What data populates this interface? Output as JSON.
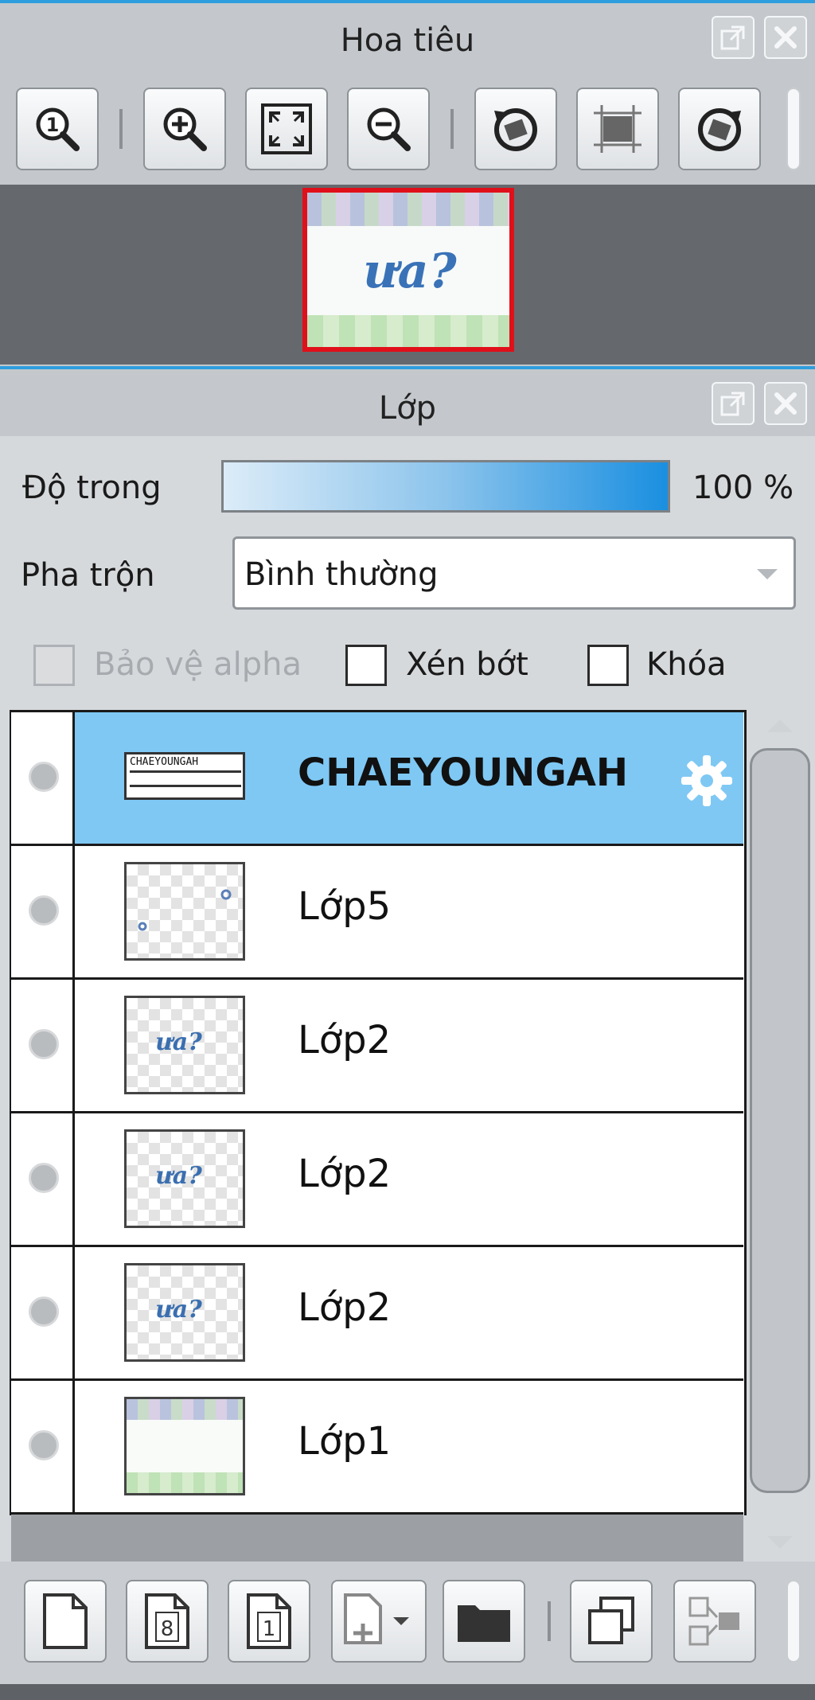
{
  "navigator": {
    "title": "Hoa tiêu",
    "toolbar_icons": [
      "zoom-actual-icon",
      "zoom-in-icon",
      "fit-screen-icon",
      "zoom-out-icon",
      "rotate-left-icon",
      "reset-rotation-icon",
      "rotate-right-icon"
    ],
    "preview_text": "ưa?"
  },
  "layers_panel": {
    "title": "Lớp",
    "opacity_label": "Độ trong",
    "opacity_value": "100 %",
    "opacity_percent": 100,
    "blend_label": "Pha trộn",
    "blend_value": "Bình thường",
    "protect_alpha_label": "Bảo vệ alpha",
    "clip_label": "Xén bớt",
    "lock_label": "Khóa",
    "layers": [
      {
        "name": "CHAEYOUNGAH",
        "selected": true,
        "thumb_text": "CHAEYOUNGAH"
      },
      {
        "name": "Lớp5",
        "selected": false,
        "thumb_text": ""
      },
      {
        "name": "Lớp2",
        "selected": false,
        "thumb_text": "ưa?"
      },
      {
        "name": "Lớp2",
        "selected": false,
        "thumb_text": "ưa?"
      },
      {
        "name": "Lớp2",
        "selected": false,
        "thumb_text": "ưa?"
      },
      {
        "name": "Lớp1",
        "selected": false,
        "thumb_text": ""
      }
    ],
    "bottom_icons": [
      "new-layer-icon",
      "new-8bit-layer-icon",
      "new-1bit-layer-icon",
      "add-layer-menu-icon",
      "new-folder-icon",
      "duplicate-layer-icon",
      "merge-layer-icon"
    ],
    "thumb_num_8": "8",
    "thumb_num_1": "1"
  },
  "colors": {
    "accent": "#2f9ede",
    "selected_row": "#7fc8f4",
    "preview_border": "#e0101a"
  }
}
